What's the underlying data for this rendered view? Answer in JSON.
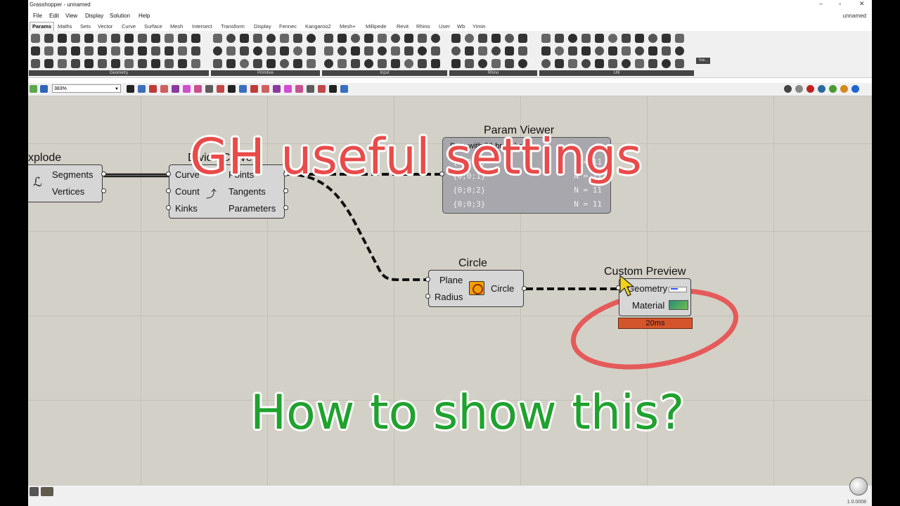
{
  "window": {
    "title": "Grasshopper - unnamed",
    "document_name": "unnamed",
    "controls": [
      "–",
      "▫",
      "✕"
    ]
  },
  "menu": [
    "File",
    "Edit",
    "View",
    "Display",
    "Solution",
    "Help"
  ],
  "tabs": [
    "Params",
    "Maths",
    "Sets",
    "Vector",
    "Curve",
    "Surface",
    "Mesh",
    "Intersect",
    "Transform",
    "Display",
    "Fennec",
    "Kangaroo2",
    "Mesh+",
    "Millipede",
    "Revit",
    "Rhino",
    "User",
    "Wb",
    "Yimin"
  ],
  "ribbon_groups": [
    "Geometry",
    "Primitive",
    "Input",
    "Rhino",
    "Util"
  ],
  "ribbon_extra_label": "Tele...",
  "toolbar": {
    "zoom": "383%"
  },
  "components": {
    "explode": {
      "title": "xplode",
      "outputs": [
        "Segments",
        "Vertices"
      ]
    },
    "divide": {
      "title": "Divide Curve",
      "inputs": [
        "Curve",
        "Count",
        "Kinks"
      ],
      "outputs": [
        "Points",
        "Tangents",
        "Parameters"
      ]
    },
    "param_viewer": {
      "title": "Param Viewer",
      "header": "Data with 50 branches",
      "rows": [
        {
          "path": "{0;0;0}",
          "count": "N = 11"
        },
        {
          "path": "{0;0;1}",
          "count": "N = 11"
        },
        {
          "path": "{0;0;2}",
          "count": "N = 11"
        },
        {
          "path": "{0;0;3}",
          "count": "N = 11"
        }
      ]
    },
    "circle": {
      "title": "Circle",
      "inputs": [
        "Plane",
        "Radius"
      ],
      "output": "Circle"
    },
    "custom_preview": {
      "title": "Custom Preview",
      "inputs": [
        "Geometry",
        "Material"
      ],
      "profiler": "20ms"
    }
  },
  "overlay": {
    "headline": "GH useful settings",
    "question": "How to show this?"
  },
  "colors": {
    "headline": "#e94a4a",
    "question": "#1fa22e",
    "profiler": "#d4552b",
    "annotation_circle": "#e55a5a",
    "canvas": "#d3d0c7"
  },
  "status": {
    "version": "1.0.0008"
  }
}
